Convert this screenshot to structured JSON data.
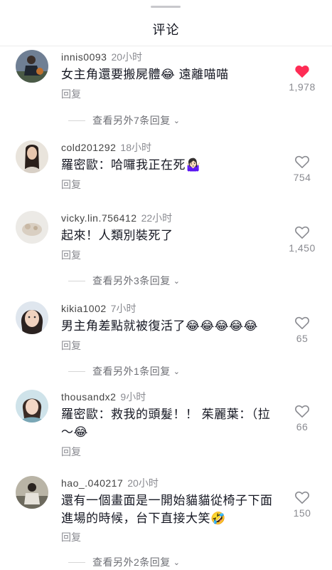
{
  "header": {
    "title": "评论"
  },
  "comments": [
    {
      "username": "innis0093",
      "time": "20小时",
      "text": "女主角還要搬屍體😂 遠離喵喵",
      "reply_label": "回复",
      "likes": "1,978",
      "liked": true,
      "more_replies": "查看另外7条回复"
    },
    {
      "username": "cold201292",
      "time": "18小时",
      "text": "羅密歐：哈囉我正在死🤷🏻‍♀️",
      "reply_label": "回复",
      "likes": "754",
      "liked": false
    },
    {
      "username": "vicky.lin.756412",
      "time": "22小时",
      "text": "起來！人類別裝死了",
      "reply_label": "回复",
      "likes": "1,450",
      "liked": false,
      "more_replies": "查看另外3条回复"
    },
    {
      "username": "kikia1002",
      "time": "7小时",
      "text": "男主角差點就被復活了😂😂😂😂😂",
      "reply_label": "回复",
      "likes": "65",
      "liked": false,
      "more_replies": "查看另外1条回复"
    },
    {
      "username": "thousandx2",
      "time": "9小时",
      "text": "羅密歐：救我的頭髮！！ 茱麗葉：（拉～😂",
      "reply_label": "回复",
      "likes": "66",
      "liked": false
    },
    {
      "username": "hao_.040217",
      "time": "20小时",
      "text": "還有一個畫面是一開始貓貓從椅子下面進場的時候，台下直接大笑🤣",
      "reply_label": "回复",
      "likes": "150",
      "liked": false,
      "more_replies": "查看另外2条回复"
    }
  ],
  "colors": {
    "liked_heart": "#fe2c55",
    "muted_text": "#8a8b91"
  },
  "icons": {
    "like": "heart-icon",
    "expand": "chevron-down-icon"
  }
}
